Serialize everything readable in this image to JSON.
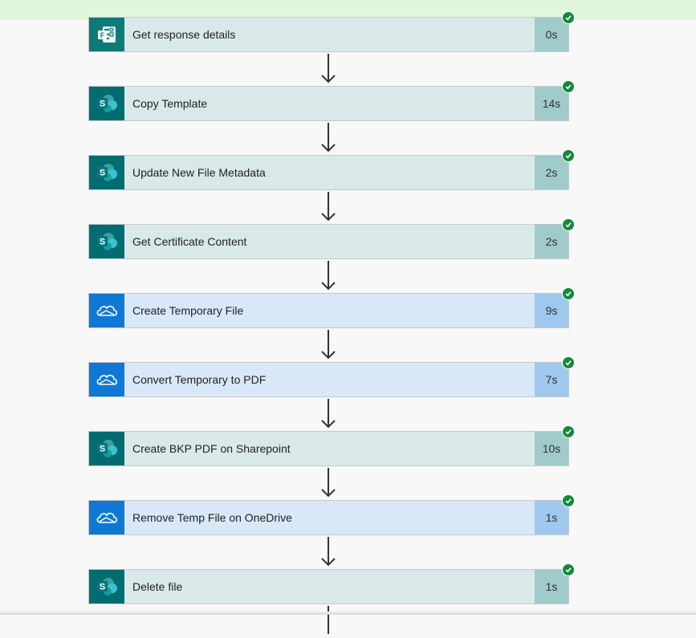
{
  "steps": [
    {
      "title": "Get response details",
      "duration": "0s",
      "connector": "forms",
      "icon": "forms-icon"
    },
    {
      "title": "Copy Template",
      "duration": "14s",
      "connector": "sharepoint",
      "icon": "sharepoint-icon"
    },
    {
      "title": "Update New File Metadata",
      "duration": "2s",
      "connector": "sharepoint",
      "icon": "sharepoint-icon"
    },
    {
      "title": "Get Certificate Content",
      "duration": "2s",
      "connector": "sharepoint",
      "icon": "sharepoint-icon"
    },
    {
      "title": "Create Temporary File",
      "duration": "9s",
      "connector": "onedrive",
      "icon": "onedrive-icon"
    },
    {
      "title": "Convert Temporary to PDF",
      "duration": "7s",
      "connector": "onedrive",
      "icon": "onedrive-icon"
    },
    {
      "title": "Create BKP PDF on Sharepoint",
      "duration": "10s",
      "connector": "sharepoint",
      "icon": "sharepoint-icon"
    },
    {
      "title": "Remove Temp File on OneDrive",
      "duration": "1s",
      "connector": "onedrive",
      "icon": "onedrive-icon"
    },
    {
      "title": "Delete file",
      "duration": "1s",
      "connector": "sharepoint",
      "icon": "sharepoint-icon"
    }
  ],
  "status": {
    "succeeded": "success-check-icon"
  },
  "colors": {
    "sharepoint": "#036c70",
    "onedrive": "#0f78d4",
    "forms": "#0d7a78",
    "success": "#138a3b",
    "banner": "#dff6dd"
  }
}
